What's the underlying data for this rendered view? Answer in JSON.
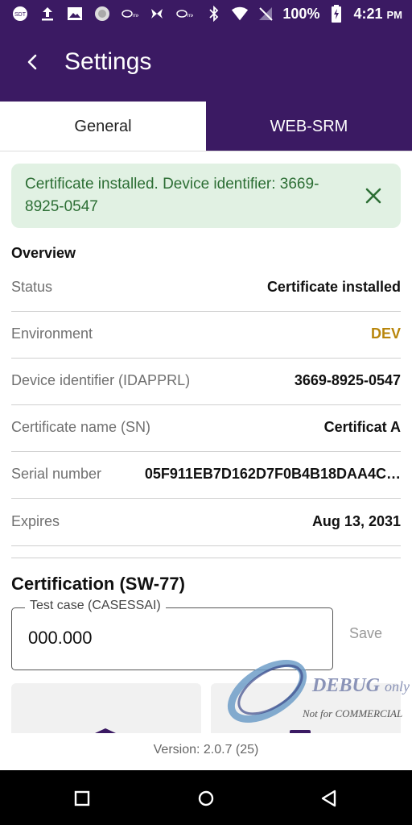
{
  "status_bar": {
    "battery": "100%",
    "time": "4:21",
    "ampm": "PM",
    "icons": [
      "sdt-icon",
      "upload-icon",
      "image-icon",
      "circle-app-icon",
      "mx-icon",
      "butterfly-icon",
      "mx-icon",
      "bluetooth-icon",
      "wifi-icon",
      "no-sim-icon",
      "battery-charging-icon"
    ]
  },
  "app_bar": {
    "title": "Settings",
    "back_icon": "chevron-left-icon"
  },
  "tabs": [
    {
      "label": "General",
      "active": true
    },
    {
      "label": "WEB-SRM",
      "active": false
    }
  ],
  "banner": {
    "text": "Certificate installed. Device identifier: 3669-8925-0547",
    "close_icon": "close-icon"
  },
  "overview": {
    "heading": "Overview",
    "rows": [
      {
        "label": "Status",
        "value": "Certificate installed"
      },
      {
        "label": "Environment",
        "value": "DEV"
      },
      {
        "label": "Device identifier (IDAPPRL)",
        "value": "3669-8925-0547"
      },
      {
        "label": "Certificate name (SN)",
        "value": "Certificat A"
      },
      {
        "label": "Serial number",
        "value": "05F911EB7D162D7F0B4B18DAA4C…"
      },
      {
        "label": "Expires",
        "value": "Aug 13, 2031"
      }
    ]
  },
  "certification": {
    "heading": "Certification (SW-77)",
    "field_label": "Test case (CASESSAI)",
    "field_value": "000.000",
    "save_label": "Save"
  },
  "watermark": {
    "main": "DEBUG",
    "suffix": "only",
    "note": "Not for COMMERCIAL"
  },
  "version": "Version: 2.0.7 (25)",
  "colors": {
    "primary": "#3b1a63",
    "success_bg": "#e1f1e3",
    "success_text": "#2c6e34",
    "dev": "#b8860b"
  }
}
